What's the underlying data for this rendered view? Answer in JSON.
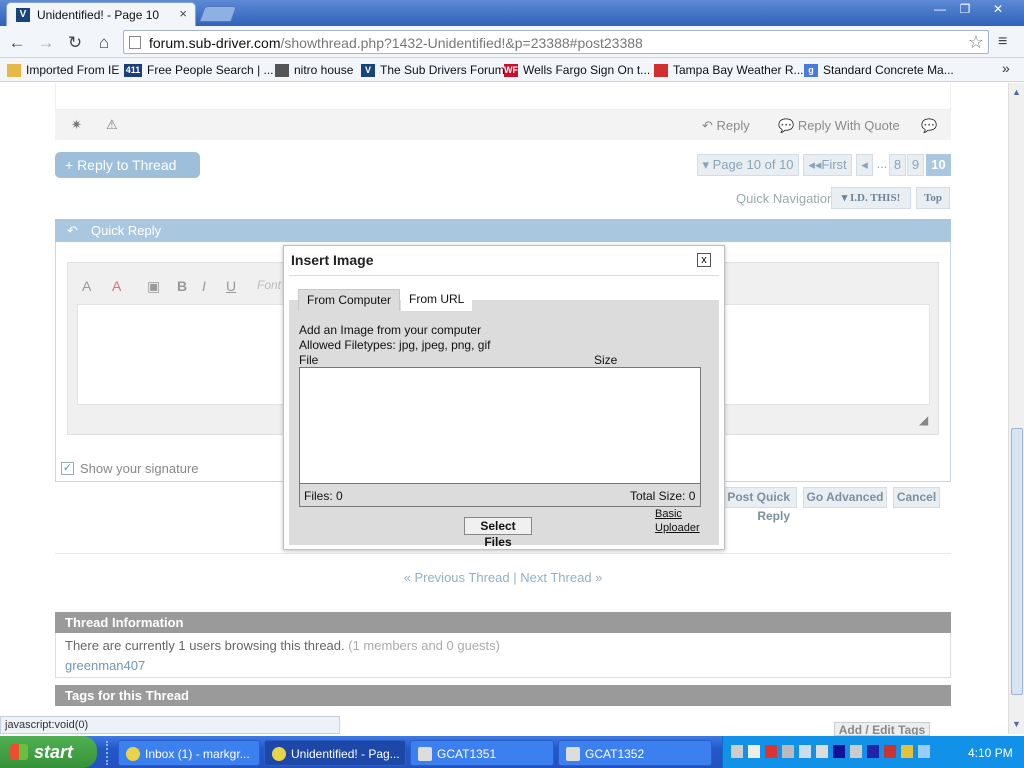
{
  "browser": {
    "tab_title": "Unidentified! - Page 10",
    "tab_close": "×",
    "window_controls": [
      "—",
      "❐",
      "✕"
    ],
    "url_host": "forum.sub-driver.com",
    "url_path": "/showthread.php?1432-Unidentified!&p=23388#post23388",
    "bookmarks": [
      {
        "label": "Imported From IE",
        "icon": "folder-icon",
        "color": "#e6b84a"
      },
      {
        "label": "Free People Search | ...",
        "icon": "411-icon",
        "color": "#1c3f7a"
      },
      {
        "label": "nitro house",
        "icon": "nitro-icon",
        "color": "#555555"
      },
      {
        "label": "The Sub Drivers Forum",
        "icon": "subdrivers-icon",
        "color": "#18447c"
      },
      {
        "label": "Wells Fargo Sign On t...",
        "icon": "wellsfargo-icon",
        "color": "#c8102e"
      },
      {
        "label": "Tampa Bay Weather R...",
        "icon": "weather-icon",
        "color": "#d03030"
      },
      {
        "label": "Standard Concrete Ma...",
        "icon": "google-icon",
        "color": "#4a7bdc"
      }
    ],
    "status_text": "javascript:void(0)"
  },
  "post_actions": {
    "reply": "Reply",
    "reply_quote": "Reply With Quote"
  },
  "reply_to_thread": "+ Reply to Thread",
  "pagination": {
    "label": "Page 10 of 10",
    "first": "First",
    "prev": "◂",
    "ellipsis": "...",
    "pages": [
      "8",
      "9",
      "10"
    ]
  },
  "quick_navigation": {
    "label": "Quick Navigation",
    "select": "I.D. THIS!",
    "top": "Top"
  },
  "quick_reply": {
    "title": "Quick Reply",
    "font_placeholder": "Font",
    "show_signature": "Show your signature",
    "buttons": [
      "Post Quick Reply",
      "Go Advanced",
      "Cancel"
    ]
  },
  "thread_nav": {
    "prev": "« Previous Thread",
    "sep": "|",
    "next": "Next Thread »"
  },
  "thread_info": {
    "title": "Thread Information",
    "browsing_text": "There are currently 1 users browsing this thread.",
    "browsing_detail": "(1 members and 0 guests)",
    "user": "greenman407"
  },
  "tags": {
    "title": "Tags for this Thread",
    "add_edit": "Add / Edit Tags"
  },
  "dialog": {
    "title": "Insert Image",
    "close": "x",
    "tabs": [
      "From Computer",
      "From URL"
    ],
    "desc1": "Add an Image from your computer",
    "desc2": "Allowed Filetypes: jpg, jpeg, png, gif",
    "col_file": "File",
    "col_size": "Size",
    "files_count": "Files: 0",
    "total_size": "Total Size: 0",
    "select_files": "Select Files",
    "basic_uploader_1": "Basic",
    "basic_uploader_2": "Uploader"
  },
  "taskbar": {
    "start": "start",
    "items": [
      {
        "label": "Inbox (1) - markgr...",
        "icon": "chrome-icon"
      },
      {
        "label": "Unidentified! - Pag...",
        "icon": "chrome-icon"
      },
      {
        "label": "GCAT1351",
        "icon": "app-icon"
      },
      {
        "label": "GCAT1352",
        "icon": "app-icon"
      }
    ],
    "clock": "4:10 PM"
  }
}
